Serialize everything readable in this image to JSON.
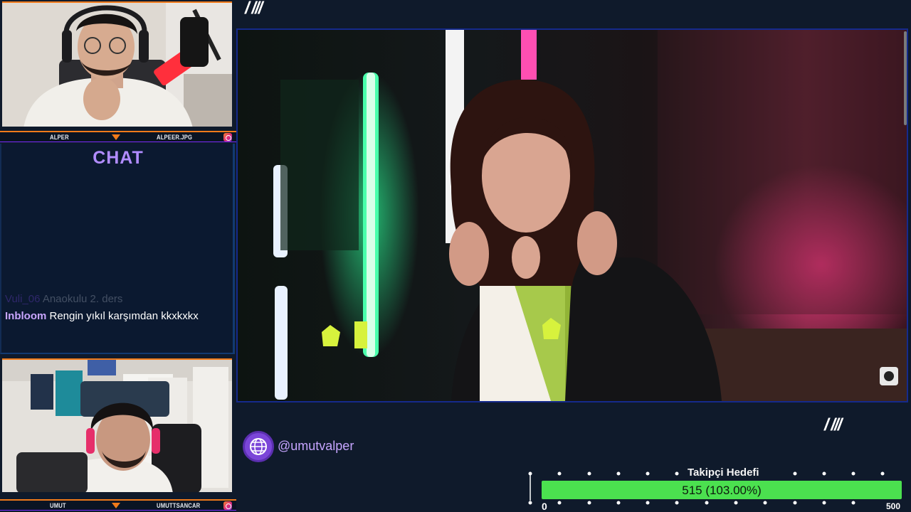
{
  "cameras": {
    "top": {
      "name": "ALPER",
      "handle": "ALPEER.JPG"
    },
    "bottom": {
      "name": "UMUT",
      "handle": "UMUTTSANCAR"
    }
  },
  "chat": {
    "title": "CHAT",
    "messages": [
      {
        "user": "Vuli_06",
        "text": "Anaokulu 2. ders"
      },
      {
        "user": "Inbloom",
        "text": "Rengin yıkıl karşımdan kkxkxkx"
      }
    ]
  },
  "overlay": {
    "top_slashes": "/ ///",
    "bottom_slashes": "/ ///",
    "social_icon": "globe-icon",
    "social_handle": "@umutvalper"
  },
  "follower_goal": {
    "title": "Takipçi Hedefi",
    "current": 515,
    "label": "515 (103.00%)",
    "min_label": "0",
    "max_label": "500",
    "progress_fraction": 1.0
  },
  "colors": {
    "accent_orange": "#f07a1a",
    "accent_purple": "#b18cff",
    "goal_fill": "#4be04f"
  }
}
